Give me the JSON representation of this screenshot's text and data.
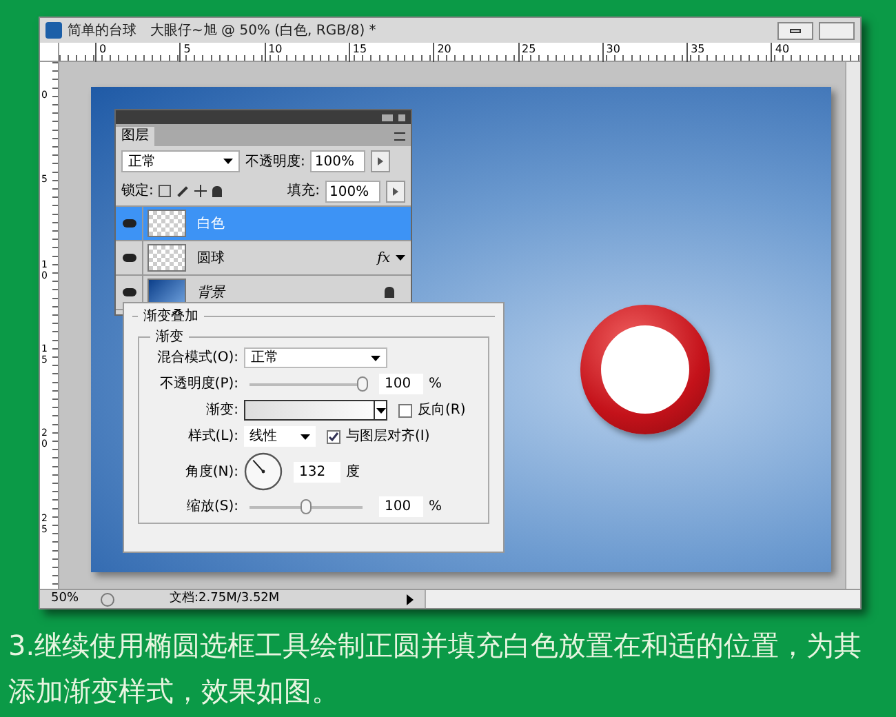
{
  "window": {
    "title": "简单的台球　大眼仔~旭 @ 50% (白色, RGB/8) *"
  },
  "ruler": {
    "top_marks": [
      "0",
      "5",
      "10",
      "15",
      "20",
      "25",
      "30",
      "35",
      "40"
    ],
    "left_marks": [
      "0",
      "5",
      "10",
      "15",
      "20",
      "25"
    ]
  },
  "layers_panel": {
    "tab": "图层",
    "blend_mode": "正常",
    "opacity_label": "不透明度:",
    "opacity": "100%",
    "lock_label": "锁定:",
    "fill_label": "填充:",
    "fill": "100%",
    "layers": [
      {
        "name": "白色",
        "selected": true,
        "kind": "transparent",
        "locked": false
      },
      {
        "name": "圆球",
        "selected": false,
        "kind": "transparent",
        "effect": "fx",
        "locked": false
      },
      {
        "name": "背景",
        "selected": false,
        "kind": "gradient",
        "locked": true
      }
    ]
  },
  "gradient_overlay": {
    "title": "渐变叠加",
    "group": "渐变",
    "blend_label": "混合模式(O):",
    "blend_mode": "正常",
    "opacity_label": "不透明度(P):",
    "opacity_slider": {
      "level": 1
    },
    "opacity": "100",
    "opacity_unit": "%",
    "gradient_label": "渐变:",
    "reverse_label": "反向(R)",
    "reverse": false,
    "style_label": "样式(L):",
    "style": "线性",
    "align_label": "与图层对齐(I)",
    "align": true,
    "angle_label": "角度(N):",
    "angle": "132",
    "angle_unit": "度",
    "scale_label": "缩放(S):",
    "scale_slider": {
      "level": 0.5
    },
    "scale": "100",
    "scale_unit": "%"
  },
  "status_bar": {
    "zoom": "50%",
    "doc": "文档:2.75M/3.52M"
  },
  "caption": "3.继续使用椭圆选框工具绘制正圆并填充白色放置在和适的位置，为其添加渐变样式，效果如图。"
}
